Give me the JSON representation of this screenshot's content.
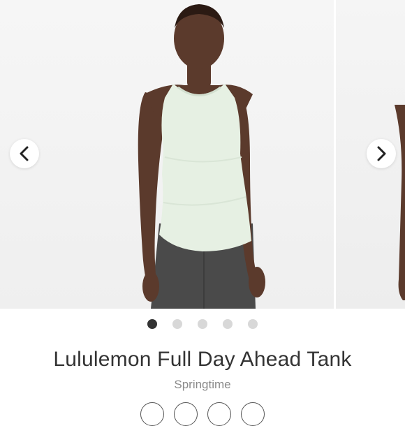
{
  "product": {
    "title": "Lululemon Full Day Ahead Tank",
    "color_name": "Springtime"
  },
  "carousel": {
    "prev_icon": "chevron-left-icon",
    "next_icon": "chevron-right-icon",
    "active_index": 0,
    "slide_count": 5
  },
  "colors": {
    "tank": "#e6f0e3",
    "pants": "#4a4a4a",
    "skin": "#5b3a2c",
    "active_dot": "#333333",
    "inactive_dot": "#d8d8d8"
  }
}
